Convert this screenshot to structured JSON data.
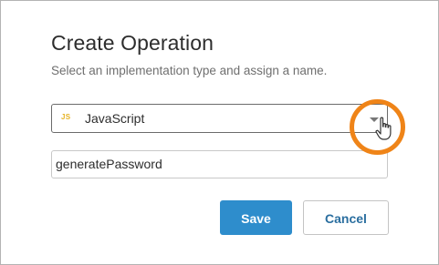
{
  "dialog": {
    "title": "Create Operation",
    "subtitle": "Select an implementation type and assign a name.",
    "implementation_select": {
      "icon_text": "JS",
      "selected": "JavaScript"
    },
    "name_input": {
      "value": "generatePassword"
    },
    "buttons": {
      "save": "Save",
      "cancel": "Cancel"
    }
  },
  "colors": {
    "primary": "#2e8dcc",
    "highlight": "#ef8418",
    "js_icon": "#e6b325"
  },
  "icons": {
    "dropdown": "chevron-down-icon",
    "cursor": "hand-pointer-icon"
  }
}
